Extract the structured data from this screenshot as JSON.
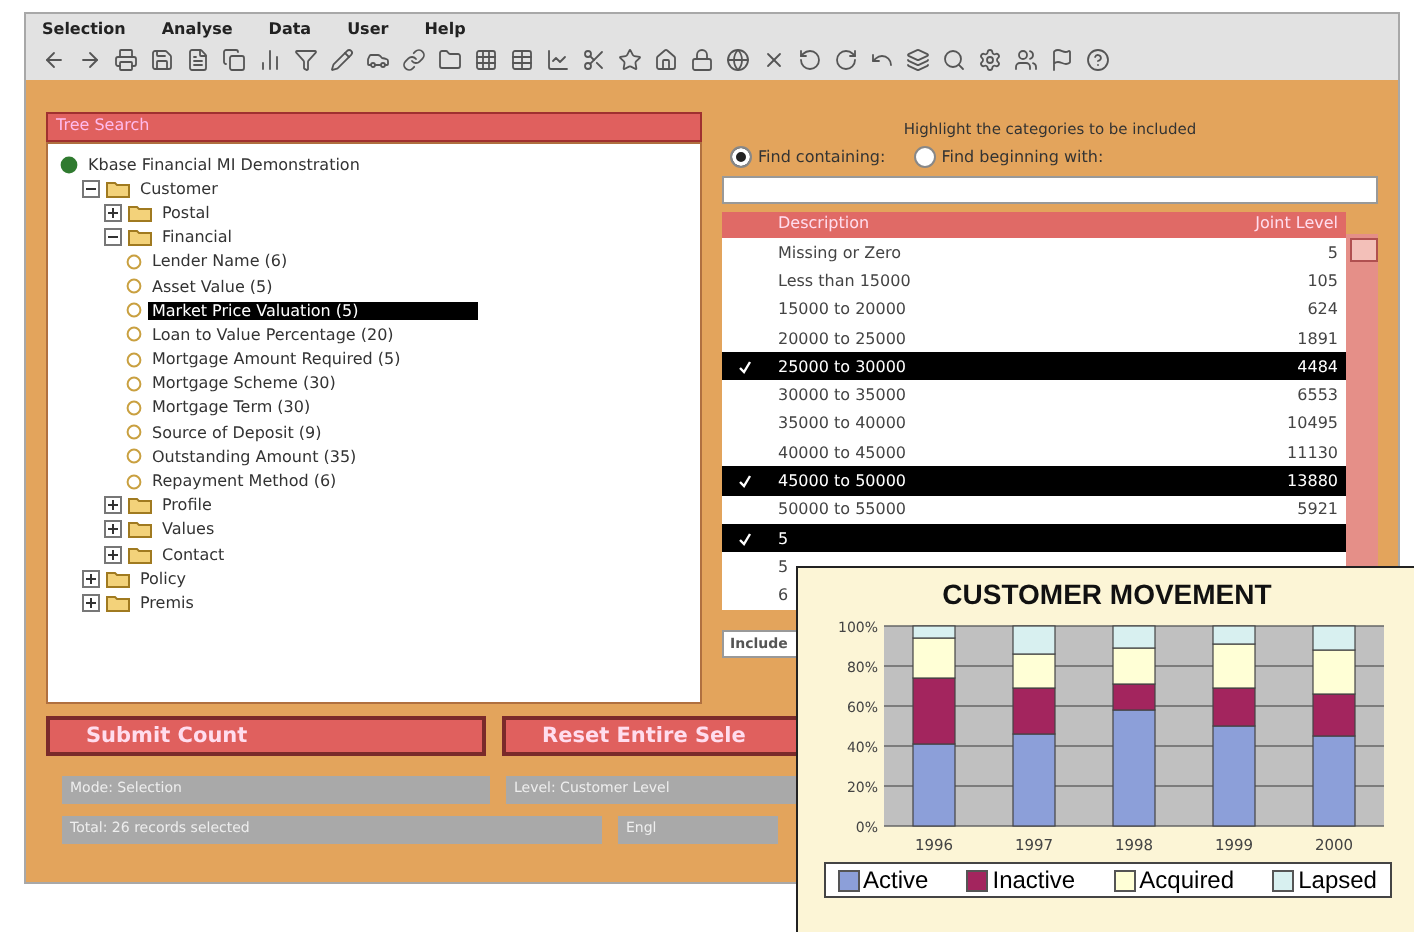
{
  "menu": [
    "Selection",
    "Analyse",
    "Data",
    "User",
    "Help"
  ],
  "tree": {
    "title": "Tree Search",
    "items": [
      {
        "label": "Kbase Financial MI Demonstration",
        "kind": "root",
        "children": [
          {
            "label": "Customer",
            "kind": "folder",
            "expanded": true,
            "children": [
              {
                "label": "Postal",
                "kind": "folder",
                "expanded": false
              },
              {
                "label": "Financial",
                "kind": "folder",
                "expanded": true,
                "children": [
                  {
                    "label": "Lender Name (6)",
                    "kind": "leaf",
                    "selected": false
                  },
                  {
                    "label": "Asset Value (5)",
                    "kind": "leaf",
                    "selected": false
                  },
                  {
                    "label": "Market Price Valuation (5)",
                    "kind": "leaf",
                    "selected": true
                  },
                  {
                    "label": "Loan to Value Percentage (20)",
                    "kind": "leaf",
                    "selected": false
                  },
                  {
                    "label": "Mortgage Amount Required (5)",
                    "kind": "leaf",
                    "selected": false
                  },
                  {
                    "label": "Mortgage Scheme (30)",
                    "kind": "leaf",
                    "selected": false
                  },
                  {
                    "label": "Mortgage Term (30)",
                    "kind": "leaf",
                    "selected": false
                  },
                  {
                    "label": "Source of Deposit (9)",
                    "kind": "leaf",
                    "selected": false
                  },
                  {
                    "label": "Outstanding Amount (35)",
                    "kind": "leaf",
                    "selected": false
                  },
                  {
                    "label": "Repayment Method (6)",
                    "kind": "leaf",
                    "selected": false
                  }
                ]
              },
              {
                "label": "Profile",
                "kind": "folder",
                "expanded": false
              },
              {
                "label": "Values",
                "kind": "folder",
                "expanded": false
              },
              {
                "label": "Contact",
                "kind": "folder",
                "expanded": false
              }
            ]
          },
          {
            "label": "Policy",
            "kind": "folder",
            "expanded": false
          },
          {
            "label": "Premis",
            "kind": "folder",
            "expanded": false
          }
        ]
      }
    ]
  },
  "categories": {
    "heading": "Highlight the categories to be included",
    "options": [
      {
        "label": "Find containing:",
        "selected": true
      },
      {
        "label": "Find beginning with:",
        "selected": false
      }
    ],
    "columns": [
      "Description",
      "Joint Level"
    ],
    "rows": [
      {
        "description": "Missing or Zero",
        "count": "5",
        "selected": false
      },
      {
        "description": "Less than 15000",
        "count": "105",
        "selected": false
      },
      {
        "description": "15000 to 20000",
        "count": "624",
        "selected": false
      },
      {
        "description": "20000 to 25000",
        "count": "1891",
        "selected": false
      },
      {
        "description": "25000 to 30000",
        "count": "4484",
        "selected": true
      },
      {
        "description": "30000 to 35000",
        "count": "6553",
        "selected": false
      },
      {
        "description": "35000 to 40000",
        "count": "10495",
        "selected": false
      },
      {
        "description": "40000 to 45000",
        "count": "11130",
        "selected": false
      },
      {
        "description": "45000 to 50000",
        "count": "13880",
        "selected": true
      },
      {
        "description": "50000 to 55000",
        "count": "5921",
        "selected": false
      },
      {
        "description": "5",
        "selected": true
      },
      {
        "description": "5",
        "selected": false
      },
      {
        "description": "6",
        "selected": false
      }
    ],
    "include": "Include"
  },
  "buttons": [
    "Submit Count",
    "Reset Entire Sele"
  ],
  "status": [
    [
      "Mode: Selection",
      "Level: Customer Level"
    ],
    [
      "Total: 26 records selected",
      "Engl"
    ]
  ],
  "chart": {
    "chart_data": {
      "type": "bar",
      "stacked": true,
      "grid": true,
      "title": "CUSTOMER MOVEMENT",
      "categories": [
        "1996",
        "1997",
        "1998",
        "1999",
        "2000"
      ],
      "ylim": [
        0,
        100
      ],
      "yticks": [
        {
          "value": 0,
          "label": "0%"
        },
        {
          "value": 20,
          "label": "20%"
        },
        {
          "value": 40,
          "label": "40%"
        },
        {
          "value": 60,
          "label": "60%"
        },
        {
          "value": 80,
          "label": "80%"
        },
        {
          "value": 100,
          "label": "100%"
        }
      ],
      "series": [
        {
          "name": "Active",
          "color": "#8c9fd9",
          "values": [
            41,
            46,
            58,
            50,
            45
          ]
        },
        {
          "name": "Inactive",
          "color": "#a3255e",
          "values": [
            33,
            23,
            13,
            19,
            21
          ]
        },
        {
          "name": "Acquired",
          "color": "#ffffd6",
          "values": [
            20,
            17,
            18,
            22,
            22
          ]
        },
        {
          "name": "Lapsed",
          "color": "#d8f0f0",
          "values": [
            6,
            14,
            11,
            9,
            12
          ]
        }
      ]
    }
  }
}
